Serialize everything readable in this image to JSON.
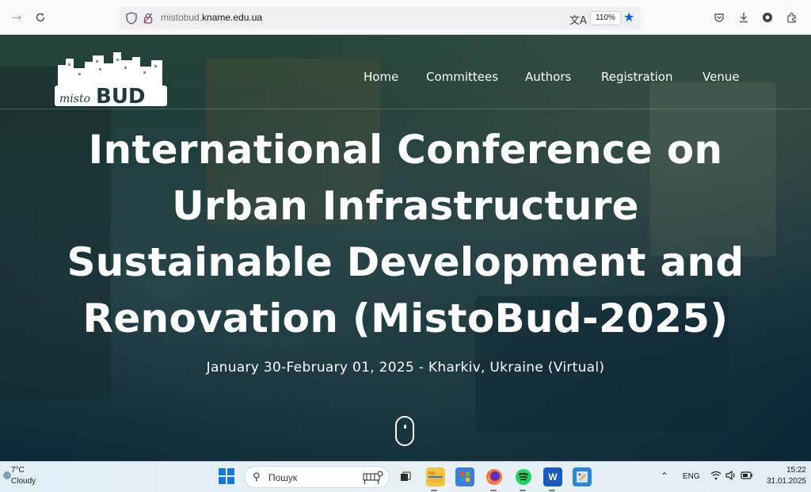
{
  "browser": {
    "url_prefix": "mistobud.",
    "url_domain": "kname.edu.ua",
    "zoom": "110%",
    "icons": {
      "back": "arrow-left-icon",
      "reload": "reload-icon",
      "shield": "shield-icon",
      "lock": "lock-icon",
      "translate": "translate-icon",
      "star": "star-icon",
      "pocket": "pocket-icon",
      "download": "download-icon",
      "account": "account-icon",
      "extensions": "extensions-icon"
    }
  },
  "site": {
    "logo_text_script": "misto",
    "logo_text_bold": "BUD",
    "nav": [
      "Home",
      "Committees",
      "Authors",
      "Registration",
      "Venue"
    ],
    "title_lines": [
      "International Conference on",
      "Urban Infrastructure",
      "Sustainable Development and",
      "Renovation (MistoBud-2025)"
    ],
    "subtitle": "January 30-February 01, 2025 - Kharkiv, Ukraine (Virtual)",
    "colors": {
      "nav_text": "#ffffff",
      "overlay": "#0f2a3c"
    }
  },
  "taskbar": {
    "weather_temp": "7°C",
    "weather_cond": "Cloudy",
    "search_placeholder": "Пошук",
    "apps": [
      "file-explorer",
      "microsoft-store",
      "firefox",
      "spotify",
      "word",
      "paint"
    ],
    "language": "ENG",
    "time": "15:22",
    "date": "31.01.2025"
  }
}
